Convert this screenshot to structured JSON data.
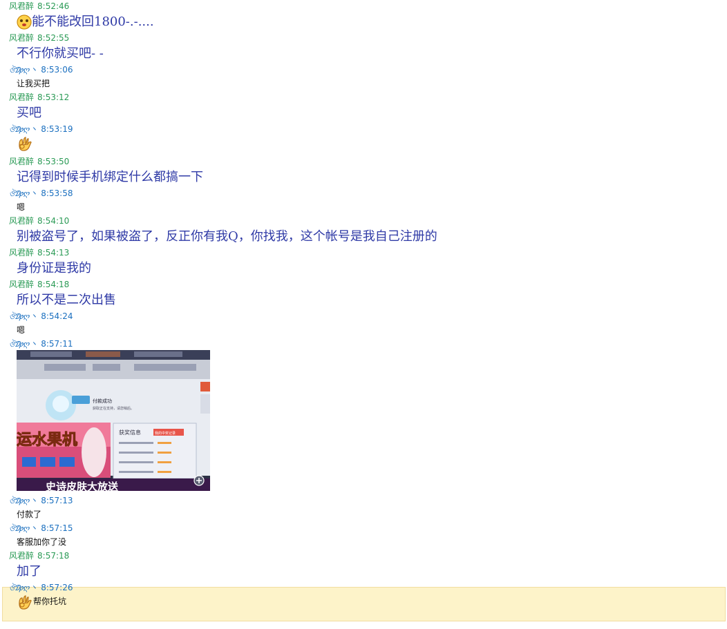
{
  "senders": {
    "a": "风君醉",
    "b": "ঔ₯ღ丶"
  },
  "messages": [
    {
      "from": "a",
      "time": "8:52:46",
      "style": "big",
      "emoji": "smiley-face-icon",
      "text": "能不能改回1800-.-...."
    },
    {
      "from": "a",
      "time": "8:52:55",
      "style": "big",
      "text": "不行你就买吧- -"
    },
    {
      "from": "b",
      "time": "8:53:06",
      "style": "small",
      "text": "让我买把"
    },
    {
      "from": "a",
      "time": "8:53:12",
      "style": "big",
      "text": "买吧"
    },
    {
      "from": "b",
      "time": "8:53:19",
      "style": "emo",
      "emoji": "ok-hand-icon",
      "text": ""
    },
    {
      "from": "a",
      "time": "8:53:50",
      "style": "big",
      "text": "记得到时候手机绑定什么都搞一下"
    },
    {
      "from": "b",
      "time": "8:53:58",
      "style": "small",
      "text": "嗯"
    },
    {
      "from": "a",
      "time": "8:54:10",
      "style": "big",
      "text": "别被盗号了，如果被盗了，反正你有我Q，你找我，这个帐号是我自己注册的"
    },
    {
      "from": "a",
      "time": "8:54:13",
      "style": "big",
      "text": "身份证是我的"
    },
    {
      "from": "a",
      "time": "8:54:18",
      "style": "big",
      "text": "所以不是二次出售"
    },
    {
      "from": "b",
      "time": "8:54:24",
      "style": "small",
      "text": "嗯"
    },
    {
      "from": "b",
      "time": "8:57:11",
      "style": "image",
      "text": ""
    },
    {
      "from": "b",
      "time": "8:57:13",
      "style": "small",
      "text": "付款了"
    },
    {
      "from": "b",
      "time": "8:57:15",
      "style": "small",
      "text": "客服加你了没"
    },
    {
      "from": "a",
      "time": "8:57:18",
      "style": "big",
      "text": "加了"
    },
    {
      "from": "b",
      "time": "8:57:26",
      "style": "small",
      "emoji": "ok-hand-icon",
      "text": "帮你托坑",
      "highlight": true
    }
  ],
  "photo": {
    "success_title": "付款成功",
    "success_sub": "获取正在支持，请您稍后。",
    "banner_left": "运水果机",
    "panel_title": "获奖信息",
    "panel_button": "我的中奖记录",
    "bottom_banner": "史诗皮肤大放送"
  },
  "colors": {
    "sender_a": "#2a9a55",
    "sender_b": "#1a6fbf",
    "message_text": "#2f3aa6",
    "highlight": "#fdf3c9"
  }
}
